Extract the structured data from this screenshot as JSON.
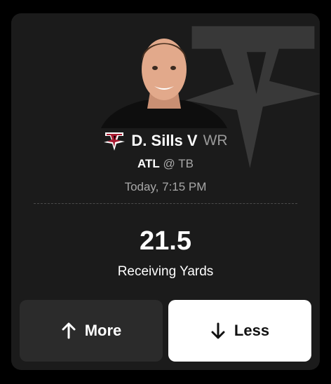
{
  "player": {
    "name": "D. Sills V",
    "position": "WR"
  },
  "matchup": {
    "team": "ATL",
    "separator": "@",
    "opponent": "TB"
  },
  "game_time": "Today, 7:15 PM",
  "projection": {
    "line": "21.5",
    "stat": "Receiving Yards"
  },
  "actions": {
    "more_label": "More",
    "less_label": "Less"
  },
  "icons": {
    "more": "arrow-up-icon",
    "less": "arrow-down-icon",
    "team": "falcons-logo-icon"
  },
  "colors": {
    "card_background": "#1b1b1b",
    "more_button": "#2b2b2b",
    "less_button": "#ffffff",
    "team_red": "#a71930"
  }
}
